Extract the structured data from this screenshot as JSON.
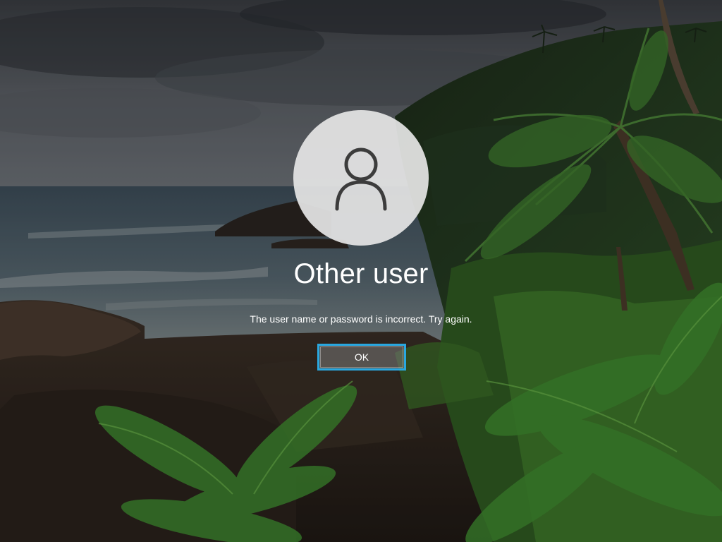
{
  "login": {
    "avatar_icon": "user-icon",
    "user_name": "Other user",
    "message": "The user name or password is incorrect. Try again.",
    "ok_label": "OK"
  },
  "colors": {
    "button_focus_border": "#2aa8e0",
    "text": "#ffffff"
  }
}
